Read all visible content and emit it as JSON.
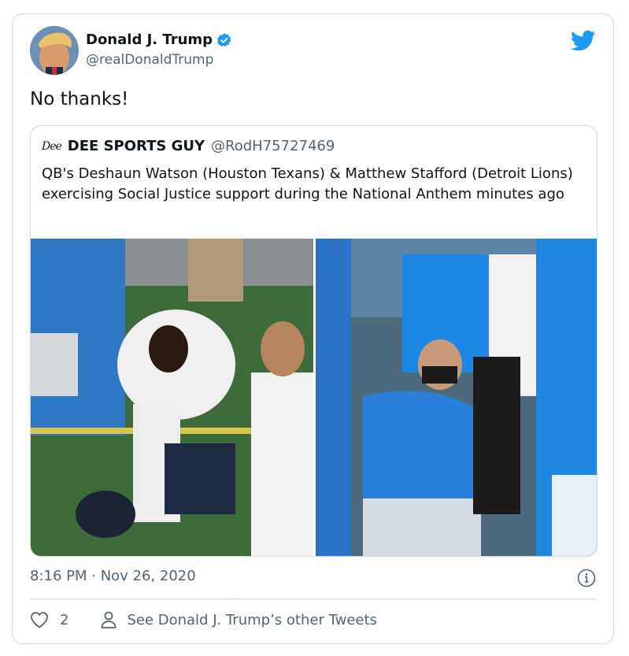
{
  "tweet": {
    "author_name": "Donald J. Trump",
    "author_handle": "@realDonaldTrump",
    "text": "No thanks!",
    "timestamp": "8:16 PM · Nov 26, 2020",
    "likes": "2",
    "more_tweets_label": "See Donald J. Trump’s other Tweets"
  },
  "quoted": {
    "logo_text": "Dee",
    "author_name": "DEE SPORTS GUY",
    "author_handle": "@RodH75727469",
    "text": "QB's Deshaun Watson (Houston Texans) & Matthew Stafford (Detroit Lions) exercising Social Justice support during the National Anthem minutes ago"
  },
  "colors": {
    "twitter_blue": "#1d9bf0",
    "secondary_text": "#536471",
    "border": "#cfd9de"
  },
  "icons": [
    "verified-badge-icon",
    "twitter-bird-icon",
    "info-icon",
    "heart-icon",
    "person-icon"
  ]
}
